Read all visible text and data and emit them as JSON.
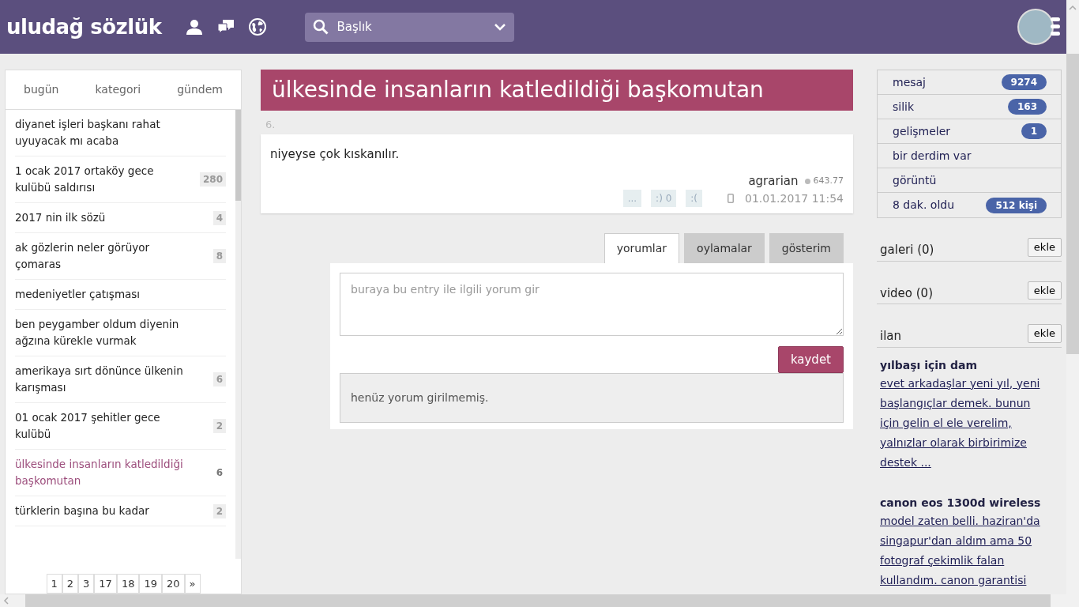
{
  "header": {
    "logo": "uludağ sözlük",
    "search": {
      "placeholder": "Başlık"
    }
  },
  "left_tabs": [
    {
      "label": "bugün",
      "selected": false
    },
    {
      "label": "kategori",
      "selected": false
    },
    {
      "label": "gündem",
      "selected": false
    }
  ],
  "topics": [
    {
      "title": "diyanet işleri başkanı rahat uyuyacak mı acaba",
      "selected": false
    },
    {
      "title": "1 ocak 2017 ortaköy gece kulübü saldırısı",
      "count": "280",
      "selected": false
    },
    {
      "title": "2017 nin ilk sözü",
      "count": "4",
      "selected": false
    },
    {
      "title": "ak gözlerin neler görüyor çomaras",
      "count": "8",
      "selected": false
    },
    {
      "title": "medeniyetler çatışması",
      "selected": false
    },
    {
      "title": "ben peygamber oldum diyenin ağzına kürekle vurmak",
      "selected": false
    },
    {
      "title": "amerikaya sırt dönünce ülkenin karışması",
      "count": "6",
      "selected": false
    },
    {
      "title": "01 ocak 2017 şehitler gece kulübü",
      "count": "2",
      "selected": false
    },
    {
      "title": "ülkesinde insanların katledildiği başkomutan",
      "count": "6",
      "selected": true
    },
    {
      "title": "türklerin başına bu kadar",
      "count": "2",
      "selected": false
    }
  ],
  "pagination": [
    "1",
    "2",
    "3",
    "17",
    "18",
    "19",
    "20",
    "»"
  ],
  "topic_title": "ülkesinde insanların katledildiği başkomutan",
  "entry": {
    "number": "6.",
    "text": "niyeyse çok kıskanılır.",
    "buttons": [
      "...",
      ":) 0",
      ":("
    ],
    "author": "agrarian",
    "score": "643.77",
    "date": "01.01.2017 11:54"
  },
  "entry_tabs": [
    {
      "label": "yorumlar",
      "selected": true
    },
    {
      "label": "oylamalar",
      "selected": false
    },
    {
      "label": "gösterim",
      "selected": false
    }
  ],
  "comment": {
    "placeholder": "buraya bu entry ile ilgili yorum gir",
    "button": "kaydet",
    "empty": "henüz yorum girilmemiş."
  },
  "menu": [
    {
      "label": "mesaj",
      "badge": "9274"
    },
    {
      "label": "silik",
      "badge": "163"
    },
    {
      "label": "gelişmeler",
      "badge": "1"
    },
    {
      "label": "bir derdim var"
    },
    {
      "label": "görüntü"
    },
    {
      "label": "8 dak. oldu",
      "badge": "512 kişi"
    }
  ],
  "sections": [
    {
      "label": "galeri (0)",
      "button": "ekle"
    },
    {
      "label": "video (0)",
      "button": "ekle"
    },
    {
      "label": "ilan",
      "button": "ekle"
    }
  ],
  "ads": [
    {
      "title": "yılbaşı için dam",
      "text": "evet arkadaşlar yeni yıl, yeni başlangıçlar demek. bunun için gelin el ele verelim, yalnızlar olarak birbirimize destek ..."
    },
    {
      "title": "canon eos 1300d wireless",
      "text": "model zaten belli. haziran'da singapur'dan aldım ama 50 fotograf çekimlik falan kullandım. canon garantisi"
    }
  ]
}
